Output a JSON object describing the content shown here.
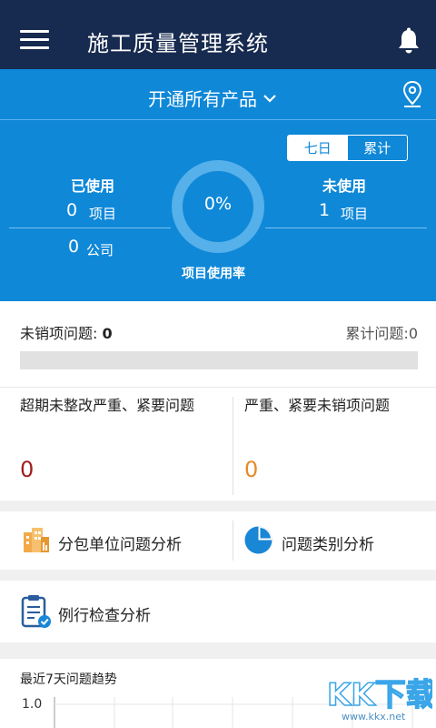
{
  "header": {
    "title": "施工质量管理系统"
  },
  "product": {
    "label": "开通所有产品"
  },
  "toggle": {
    "seven_days": "七日",
    "cumulative": "累计"
  },
  "stats": {
    "used_label": "已使用",
    "used_projects": "0",
    "project_unit": "项目",
    "used_companies": "0",
    "company_unit": "公司",
    "unused_label": "未使用",
    "unused_projects": "1",
    "unused_unit": "项目",
    "usage_rate": "0%",
    "usage_rate_fraction": 0,
    "usage_rate_label": "项目使用率"
  },
  "issues": {
    "unsold_label": "未销项问题: ",
    "unsold_value": "0",
    "cumulative_text": "累计问题:0",
    "progress_fraction": 0,
    "overdue_label": "超期未整改严重、紧要问题",
    "overdue_value": "0",
    "serious_label": "严重、紧要未销项问题",
    "serious_value": "0"
  },
  "analysis": {
    "subcontractor": "分包单位问题分析",
    "category": "问题类别分析",
    "routine": "例行检查分析"
  },
  "trend": {
    "title": "最近7天问题趋势",
    "y_tick": "1.0"
  },
  "watermark": {
    "text": "KK下载",
    "url": "www.kkx.net"
  },
  "colors": {
    "header_bg": "#172a4f",
    "accent_blue": "#0f88d8",
    "overdue_red": "#a01e1e",
    "serious_orange": "#e68a2a"
  }
}
